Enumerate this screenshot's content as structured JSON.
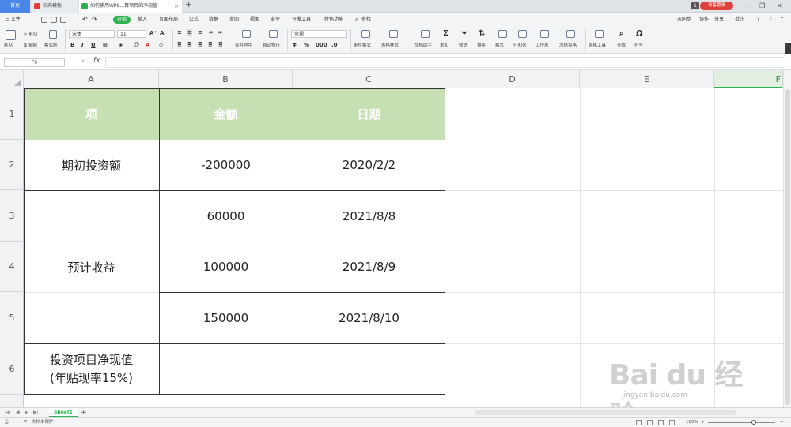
{
  "tabs": {
    "home": "首页",
    "template": "稻壳模板",
    "document": "如何使用WPS...算项目的净现值",
    "add": "+"
  },
  "titlebar": {
    "badge": "1",
    "login": "访客登录"
  },
  "menu": {
    "file": "三 文件",
    "items": [
      "开始",
      "插入",
      "页面布局",
      "公式",
      "数据",
      "审阅",
      "视图",
      "安全",
      "开发工具",
      "特色功能"
    ],
    "search": "查找",
    "sync": "未同步",
    "collab": "协作",
    "share": "分享",
    "annotate": "批注"
  },
  "ribbon": {
    "paste": "粘贴",
    "cut": "剪切",
    "copy": "复制",
    "format_painter": "格式刷",
    "font_name": "宋体",
    "font_size": "11",
    "merge_center": "合并居中",
    "auto_wrap": "自动换行",
    "number_format": "常规",
    "conditional_format": "条件格式",
    "table_style": "表格样式",
    "doc_assistant": "文档助手",
    "sum": "求和",
    "filter": "筛选",
    "sort": "排序",
    "format": "格式",
    "row_col": "行和列",
    "worksheet": "工作表",
    "freeze": "冻结窗格",
    "table_tools": "表格工具",
    "find": "查找",
    "symbol": "符号"
  },
  "formula_bar": {
    "name_box": "F9",
    "fx": "fx"
  },
  "columns": [
    "A",
    "B",
    "C",
    "D",
    "E",
    "F"
  ],
  "rows": [
    "1",
    "2",
    "3",
    "4",
    "5",
    "6"
  ],
  "table": {
    "headers": [
      "项",
      "金额",
      "日期"
    ],
    "initial_label": "期初投资额",
    "initial_amount": "-200000",
    "initial_date": "2020/2/2",
    "expected_label": "预计收益",
    "amounts": [
      "60000",
      "100000",
      "150000"
    ],
    "dates": [
      "2021/8/8",
      "2021/8/9",
      "2021/8/10"
    ],
    "npv_label_line1": "投资项目净现值",
    "npv_label_line2": "(年贴现率15%)"
  },
  "sheet_tabs": {
    "sheet1": "Sheet1",
    "add": "+"
  },
  "status": {
    "protect": "文档未保护",
    "zoom": "180%"
  },
  "watermark": {
    "main": "Bai du 经验",
    "sub": "jingyan.baidu.com"
  },
  "colors": {
    "header_fill": "#c6e0b4",
    "accent": "#2bb24c",
    "home_tab": "#4a86e8",
    "login": "#e0403a"
  }
}
